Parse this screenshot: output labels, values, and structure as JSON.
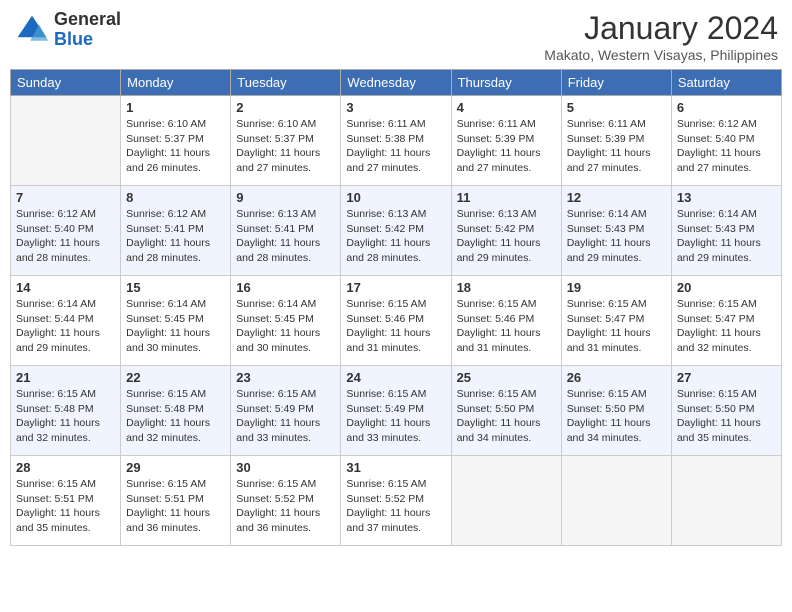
{
  "header": {
    "logo": {
      "general": "General",
      "blue": "Blue"
    },
    "title": "January 2024",
    "location": "Makato, Western Visayas, Philippines"
  },
  "days_of_week": [
    "Sunday",
    "Monday",
    "Tuesday",
    "Wednesday",
    "Thursday",
    "Friday",
    "Saturday"
  ],
  "weeks": [
    [
      {
        "day": null,
        "info": null
      },
      {
        "day": "1",
        "info": "Sunrise: 6:10 AM\nSunset: 5:37 PM\nDaylight: 11 hours\nand 26 minutes."
      },
      {
        "day": "2",
        "info": "Sunrise: 6:10 AM\nSunset: 5:37 PM\nDaylight: 11 hours\nand 27 minutes."
      },
      {
        "day": "3",
        "info": "Sunrise: 6:11 AM\nSunset: 5:38 PM\nDaylight: 11 hours\nand 27 minutes."
      },
      {
        "day": "4",
        "info": "Sunrise: 6:11 AM\nSunset: 5:39 PM\nDaylight: 11 hours\nand 27 minutes."
      },
      {
        "day": "5",
        "info": "Sunrise: 6:11 AM\nSunset: 5:39 PM\nDaylight: 11 hours\nand 27 minutes."
      },
      {
        "day": "6",
        "info": "Sunrise: 6:12 AM\nSunset: 5:40 PM\nDaylight: 11 hours\nand 27 minutes."
      }
    ],
    [
      {
        "day": "7",
        "info": "Sunrise: 6:12 AM\nSunset: 5:40 PM\nDaylight: 11 hours\nand 28 minutes."
      },
      {
        "day": "8",
        "info": "Sunrise: 6:12 AM\nSunset: 5:41 PM\nDaylight: 11 hours\nand 28 minutes."
      },
      {
        "day": "9",
        "info": "Sunrise: 6:13 AM\nSunset: 5:41 PM\nDaylight: 11 hours\nand 28 minutes."
      },
      {
        "day": "10",
        "info": "Sunrise: 6:13 AM\nSunset: 5:42 PM\nDaylight: 11 hours\nand 28 minutes."
      },
      {
        "day": "11",
        "info": "Sunrise: 6:13 AM\nSunset: 5:42 PM\nDaylight: 11 hours\nand 29 minutes."
      },
      {
        "day": "12",
        "info": "Sunrise: 6:14 AM\nSunset: 5:43 PM\nDaylight: 11 hours\nand 29 minutes."
      },
      {
        "day": "13",
        "info": "Sunrise: 6:14 AM\nSunset: 5:43 PM\nDaylight: 11 hours\nand 29 minutes."
      }
    ],
    [
      {
        "day": "14",
        "info": "Sunrise: 6:14 AM\nSunset: 5:44 PM\nDaylight: 11 hours\nand 29 minutes."
      },
      {
        "day": "15",
        "info": "Sunrise: 6:14 AM\nSunset: 5:45 PM\nDaylight: 11 hours\nand 30 minutes."
      },
      {
        "day": "16",
        "info": "Sunrise: 6:14 AM\nSunset: 5:45 PM\nDaylight: 11 hours\nand 30 minutes."
      },
      {
        "day": "17",
        "info": "Sunrise: 6:15 AM\nSunset: 5:46 PM\nDaylight: 11 hours\nand 31 minutes."
      },
      {
        "day": "18",
        "info": "Sunrise: 6:15 AM\nSunset: 5:46 PM\nDaylight: 11 hours\nand 31 minutes."
      },
      {
        "day": "19",
        "info": "Sunrise: 6:15 AM\nSunset: 5:47 PM\nDaylight: 11 hours\nand 31 minutes."
      },
      {
        "day": "20",
        "info": "Sunrise: 6:15 AM\nSunset: 5:47 PM\nDaylight: 11 hours\nand 32 minutes."
      }
    ],
    [
      {
        "day": "21",
        "info": "Sunrise: 6:15 AM\nSunset: 5:48 PM\nDaylight: 11 hours\nand 32 minutes."
      },
      {
        "day": "22",
        "info": "Sunrise: 6:15 AM\nSunset: 5:48 PM\nDaylight: 11 hours\nand 32 minutes."
      },
      {
        "day": "23",
        "info": "Sunrise: 6:15 AM\nSunset: 5:49 PM\nDaylight: 11 hours\nand 33 minutes."
      },
      {
        "day": "24",
        "info": "Sunrise: 6:15 AM\nSunset: 5:49 PM\nDaylight: 11 hours\nand 33 minutes."
      },
      {
        "day": "25",
        "info": "Sunrise: 6:15 AM\nSunset: 5:50 PM\nDaylight: 11 hours\nand 34 minutes."
      },
      {
        "day": "26",
        "info": "Sunrise: 6:15 AM\nSunset: 5:50 PM\nDaylight: 11 hours\nand 34 minutes."
      },
      {
        "day": "27",
        "info": "Sunrise: 6:15 AM\nSunset: 5:50 PM\nDaylight: 11 hours\nand 35 minutes."
      }
    ],
    [
      {
        "day": "28",
        "info": "Sunrise: 6:15 AM\nSunset: 5:51 PM\nDaylight: 11 hours\nand 35 minutes."
      },
      {
        "day": "29",
        "info": "Sunrise: 6:15 AM\nSunset: 5:51 PM\nDaylight: 11 hours\nand 36 minutes."
      },
      {
        "day": "30",
        "info": "Sunrise: 6:15 AM\nSunset: 5:52 PM\nDaylight: 11 hours\nand 36 minutes."
      },
      {
        "day": "31",
        "info": "Sunrise: 6:15 AM\nSunset: 5:52 PM\nDaylight: 11 hours\nand 37 minutes."
      },
      {
        "day": null,
        "info": null
      },
      {
        "day": null,
        "info": null
      },
      {
        "day": null,
        "info": null
      }
    ]
  ]
}
